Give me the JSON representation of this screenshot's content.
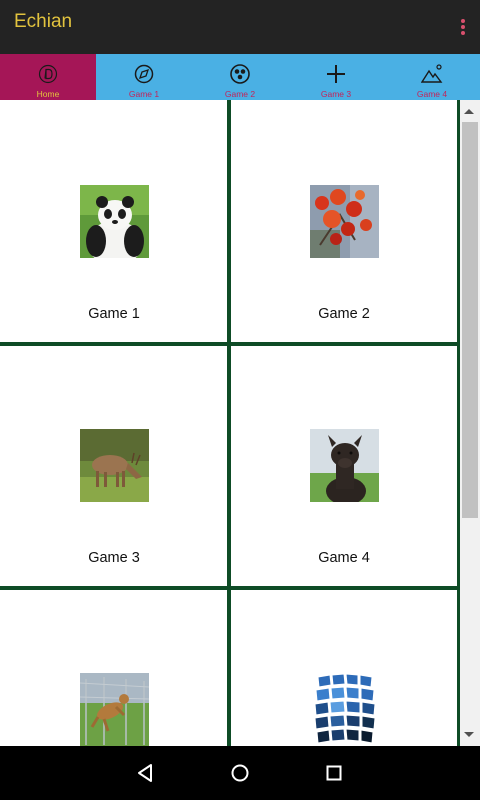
{
  "app": {
    "title": "Echian"
  },
  "tabs": [
    {
      "label": "Home",
      "icon": "home-circle-icon",
      "active": true
    },
    {
      "label": "Game 1",
      "icon": "compass-icon",
      "active": false
    },
    {
      "label": "Game 2",
      "icon": "palette-icon",
      "active": false
    },
    {
      "label": "Game 3",
      "icon": "plus-icon",
      "active": false
    },
    {
      "label": "Game 4",
      "icon": "mountain-icon",
      "active": false
    }
  ],
  "grid": {
    "items": [
      {
        "label": "Game 1",
        "image": "panda-photo"
      },
      {
        "label": "Game 2",
        "image": "red-flowers-photo"
      },
      {
        "label": "Game 3",
        "image": "deer-photo"
      },
      {
        "label": "Game 4",
        "image": "alpaca-photo"
      },
      {
        "label": "",
        "image": "dog-photo"
      },
      {
        "label": "",
        "image": "blue-tiles-photo"
      }
    ]
  },
  "colors": {
    "appbar": "#232323",
    "title": "#e2c33e",
    "tab_bg": "#4ab0e4",
    "tab_active_bg": "#a51657",
    "tab_text": "#c2245a",
    "grid_lines": "#0e4c26"
  }
}
